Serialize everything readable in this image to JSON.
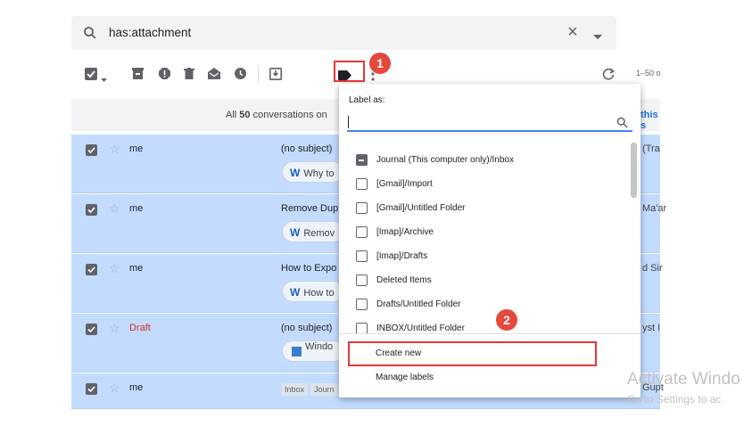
{
  "search": {
    "query": "has:attachment",
    "clear_icon": "×"
  },
  "toolbar": {
    "range_text": "1–50 o"
  },
  "banner": {
    "prefix": "All",
    "count": "50",
    "suffix": "conversations on",
    "link": "this s"
  },
  "rows": [
    {
      "sender": "me",
      "subject": "(no subject)",
      "chip_text": "Why to",
      "chip_icon": "W",
      "tail": "(Tra"
    },
    {
      "sender": "me",
      "subject": "Remove Dup",
      "chip_text": "Remov",
      "chip_icon": "W",
      "tail": "Ma'ar"
    },
    {
      "sender": "me",
      "subject": "How to Expo",
      "chip_text": "How to",
      "chip_icon": "W",
      "tail": "d Sir"
    },
    {
      "sender": "Draft",
      "subject": "(no subject)",
      "chip_text": "Windo",
      "chip_icon": "windows-image",
      "tail": "yst I"
    },
    {
      "sender": "me",
      "tags": [
        "Inbox",
        "Journ"
      ],
      "tail": "Gupt"
    }
  ],
  "menu": {
    "title": "Label as:",
    "labels": [
      "Journal (This computer only)/Inbox",
      "[Gmail]/Import",
      "[Gmail]/Untitled Folder",
      "[Imap]/Archive",
      "[Imap]/Drafts",
      "Deleted Items",
      "Drafts/Untitled Folder",
      "INBOX/Untitled Folder"
    ],
    "create_new": "Create new",
    "manage_labels": "Manage labels"
  },
  "badges": {
    "one": "1",
    "two": "2"
  },
  "watermark": {
    "line1": "Activate Windo",
    "line2": "Go to Settings to ac"
  },
  "colors": {
    "selected_row": "#c2dbff",
    "highlight": "#e53935",
    "accent": "#4285f4"
  }
}
